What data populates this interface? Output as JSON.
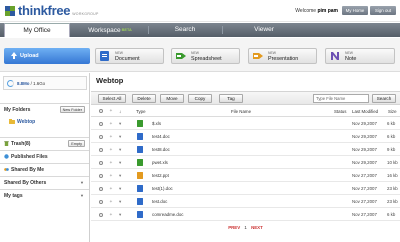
{
  "header": {
    "brand": "thinkfree",
    "brand_suffix": "",
    "beta": "WORKGROUP",
    "welcome_prefix": "Welcome",
    "user": "pim pam",
    "home_label": "My Home",
    "signout_label": "Sign out"
  },
  "nav": {
    "tabs": [
      {
        "label": "My Office",
        "active": true
      },
      {
        "label": "Workspace",
        "badge": "BETA",
        "active": false
      },
      {
        "label": "Search",
        "active": false
      },
      {
        "label": "Viewer",
        "active": false
      }
    ]
  },
  "create": {
    "upload_label": "Upload",
    "new_small": "NEW",
    "buttons": [
      {
        "label": "Document",
        "icon": "document-icon",
        "color": "#2f6bc9"
      },
      {
        "label": "Spreadsheet",
        "icon": "spreadsheet-icon",
        "color": "#3a9a2e"
      },
      {
        "label": "Presentation",
        "icon": "presentation-icon",
        "color": "#e39a1f"
      },
      {
        "label": "Note",
        "icon": "note-icon",
        "color": "#6b4fb3"
      }
    ]
  },
  "sidebar": {
    "storage": {
      "used": "8.8Mo",
      "total": "1.6Go"
    },
    "my_folders_title": "My Folders",
    "new_folder_label": "New Folder",
    "active_folder": "Webtop",
    "trash_label": "Trash(8)",
    "empty_label": "Empty",
    "published_label": "Published Files",
    "shared_by_me_label": "Shared By Me",
    "shared_by_others_label": "Shared By Others",
    "my_tags_label": "My tags"
  },
  "main": {
    "title": "Webtop",
    "toolbar": {
      "select_all": "Select All",
      "delete": "Delete",
      "move": "Move",
      "copy": "Copy",
      "tag": "Tag",
      "search_placeholder": "Type File Name",
      "search_button": "Search"
    },
    "columns": {
      "type": "Type",
      "file_name": "File Name",
      "status": "Status",
      "last_modified": "Last Modified",
      "size": "Size"
    },
    "files": [
      {
        "name": "$.xls",
        "kind": "xls",
        "status": "",
        "modified": "Nov 29,2007",
        "size": "6 kb"
      },
      {
        "name": "test4.doc",
        "kind": "doc",
        "status": "",
        "modified": "Nov 29,2007",
        "size": "6 kb"
      },
      {
        "name": "test8.doc",
        "kind": "doc",
        "status": "",
        "modified": "Nov 29,2007",
        "size": "9 kb"
      },
      {
        "name": "pwet.xls",
        "kind": "xls",
        "status": "",
        "modified": "Nov 29,2007",
        "size": "10 kb"
      },
      {
        "name": "test2.ppt",
        "kind": "ppt",
        "status": "",
        "modified": "Nov 27,2007",
        "size": "16 kb"
      },
      {
        "name": "test(1).doc",
        "kind": "doc",
        "status": "",
        "modified": "Nov 27,2007",
        "size": "23 kb"
      },
      {
        "name": "test.doc",
        "kind": "doc",
        "status": "",
        "modified": "Nov 27,2007",
        "size": "23 kb"
      },
      {
        "name": "comreadme.doc",
        "kind": "doc",
        "status": "",
        "modified": "Nov 27,2007",
        "size": "6 kb"
      }
    ],
    "pager": {
      "prev": "PREV",
      "page": "1",
      "next": "NEXT"
    }
  }
}
